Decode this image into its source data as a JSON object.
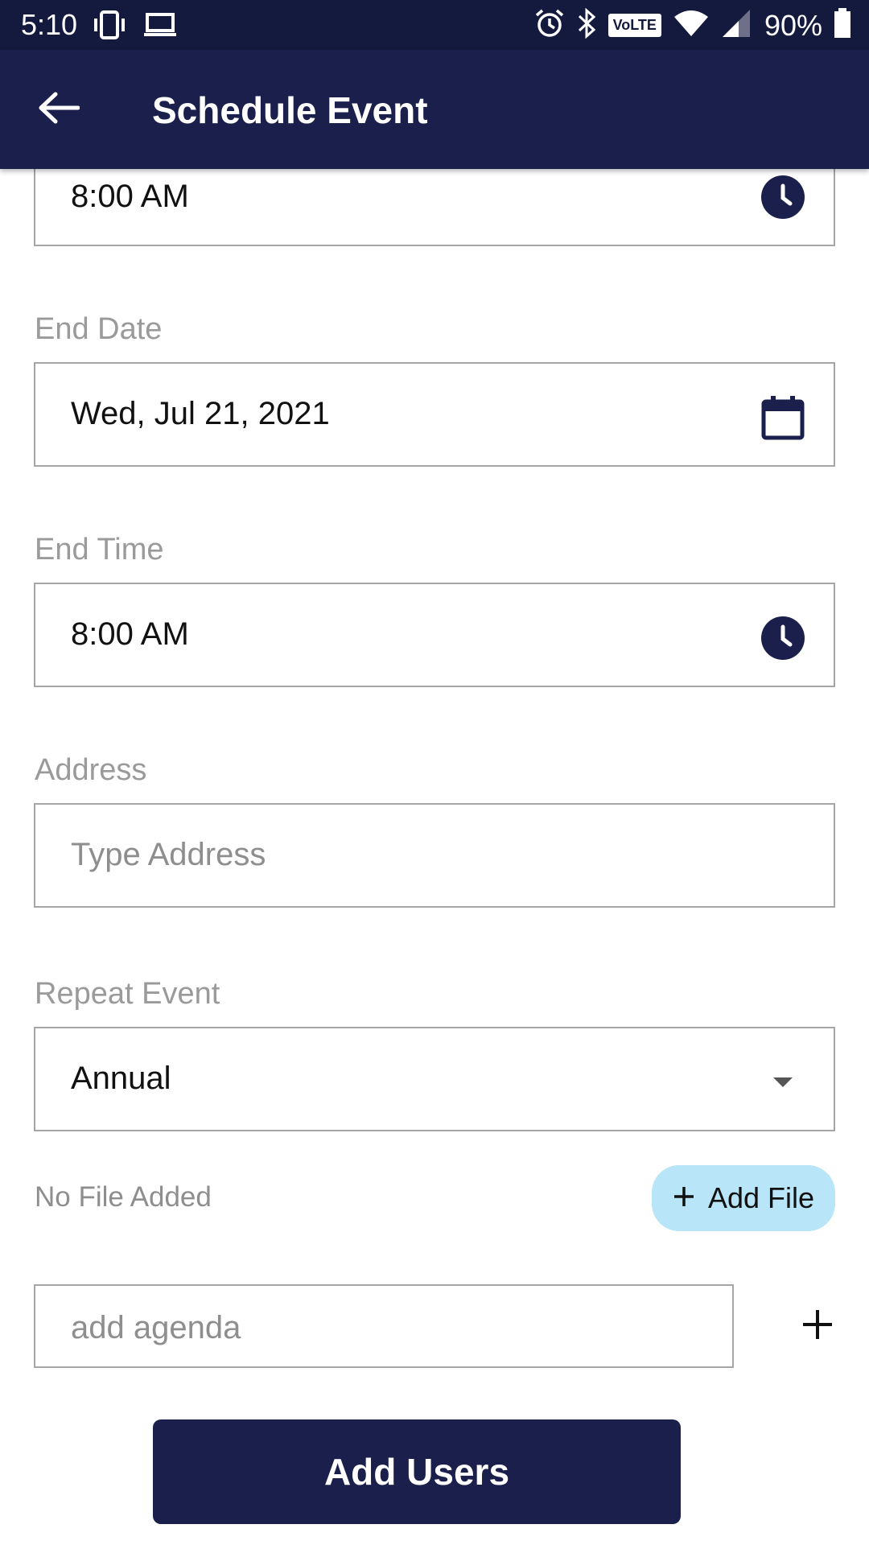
{
  "status_bar": {
    "time": "5:10",
    "battery": "90%",
    "volte": "VoLTE",
    "icons_left": [
      "phone-vibrate-icon",
      "laptop-icon"
    ],
    "icons_right": [
      "alarm-icon",
      "bluetooth-icon",
      "volte-icon",
      "wifi-icon",
      "signal-icon",
      "battery-icon"
    ]
  },
  "app_bar": {
    "title": "Schedule Event",
    "back_icon": "arrow-left-icon"
  },
  "form": {
    "start_time": {
      "value": "8:00 AM",
      "icon": "clock-icon"
    },
    "end_date": {
      "label": "End Date",
      "value": "Wed, Jul 21, 2021",
      "icon": "calendar-icon"
    },
    "end_time": {
      "label": "End Time",
      "value": "8:00 AM",
      "icon": "clock-icon"
    },
    "address": {
      "label": "Address",
      "placeholder": "Type Address"
    },
    "repeat_event": {
      "label": "Repeat Event",
      "value": "Annual",
      "icon": "dropdown-arrow-icon"
    },
    "file": {
      "status": "No File Added",
      "button_label": "Add File"
    },
    "agenda": {
      "placeholder": "add agenda"
    },
    "add_users_label": "Add Users"
  },
  "colors": {
    "primary": "#1a1f4b",
    "status_bar": "#141a3d",
    "add_file_bg": "#b8e5f7",
    "label_gray": "#9a9a9a",
    "border": "#a6a6a6"
  }
}
